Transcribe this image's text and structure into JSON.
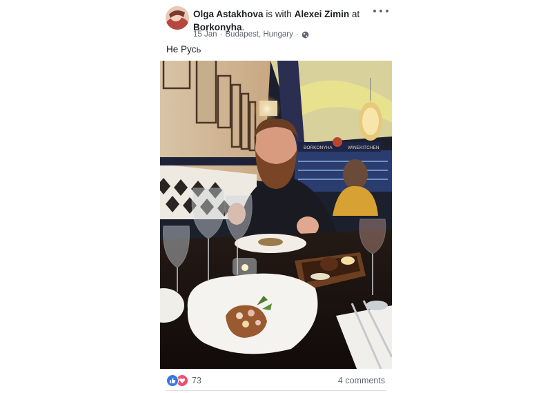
{
  "post": {
    "author": "Olga Astakhova",
    "with_text": "is with",
    "tagged": "Alexei Zimin",
    "at_text": "at",
    "place": "Borkonyha",
    "place_suffix": ".",
    "date": "15 Jan",
    "separator": "·",
    "location": "Budapest, Hungary",
    "separator2": "·",
    "privacy_icon": "globe-icon",
    "text": "Не Русь",
    "photo_signs": [
      "BORKONYHA",
      "WINEKITCHEN"
    ]
  },
  "footer": {
    "reaction_icons": [
      "like-icon",
      "love-icon"
    ],
    "reaction_count": "73",
    "comments": "4 comments"
  },
  "colors": {
    "like": "#3578e5",
    "love": "#f0506e",
    "meta_text": "#616770"
  }
}
